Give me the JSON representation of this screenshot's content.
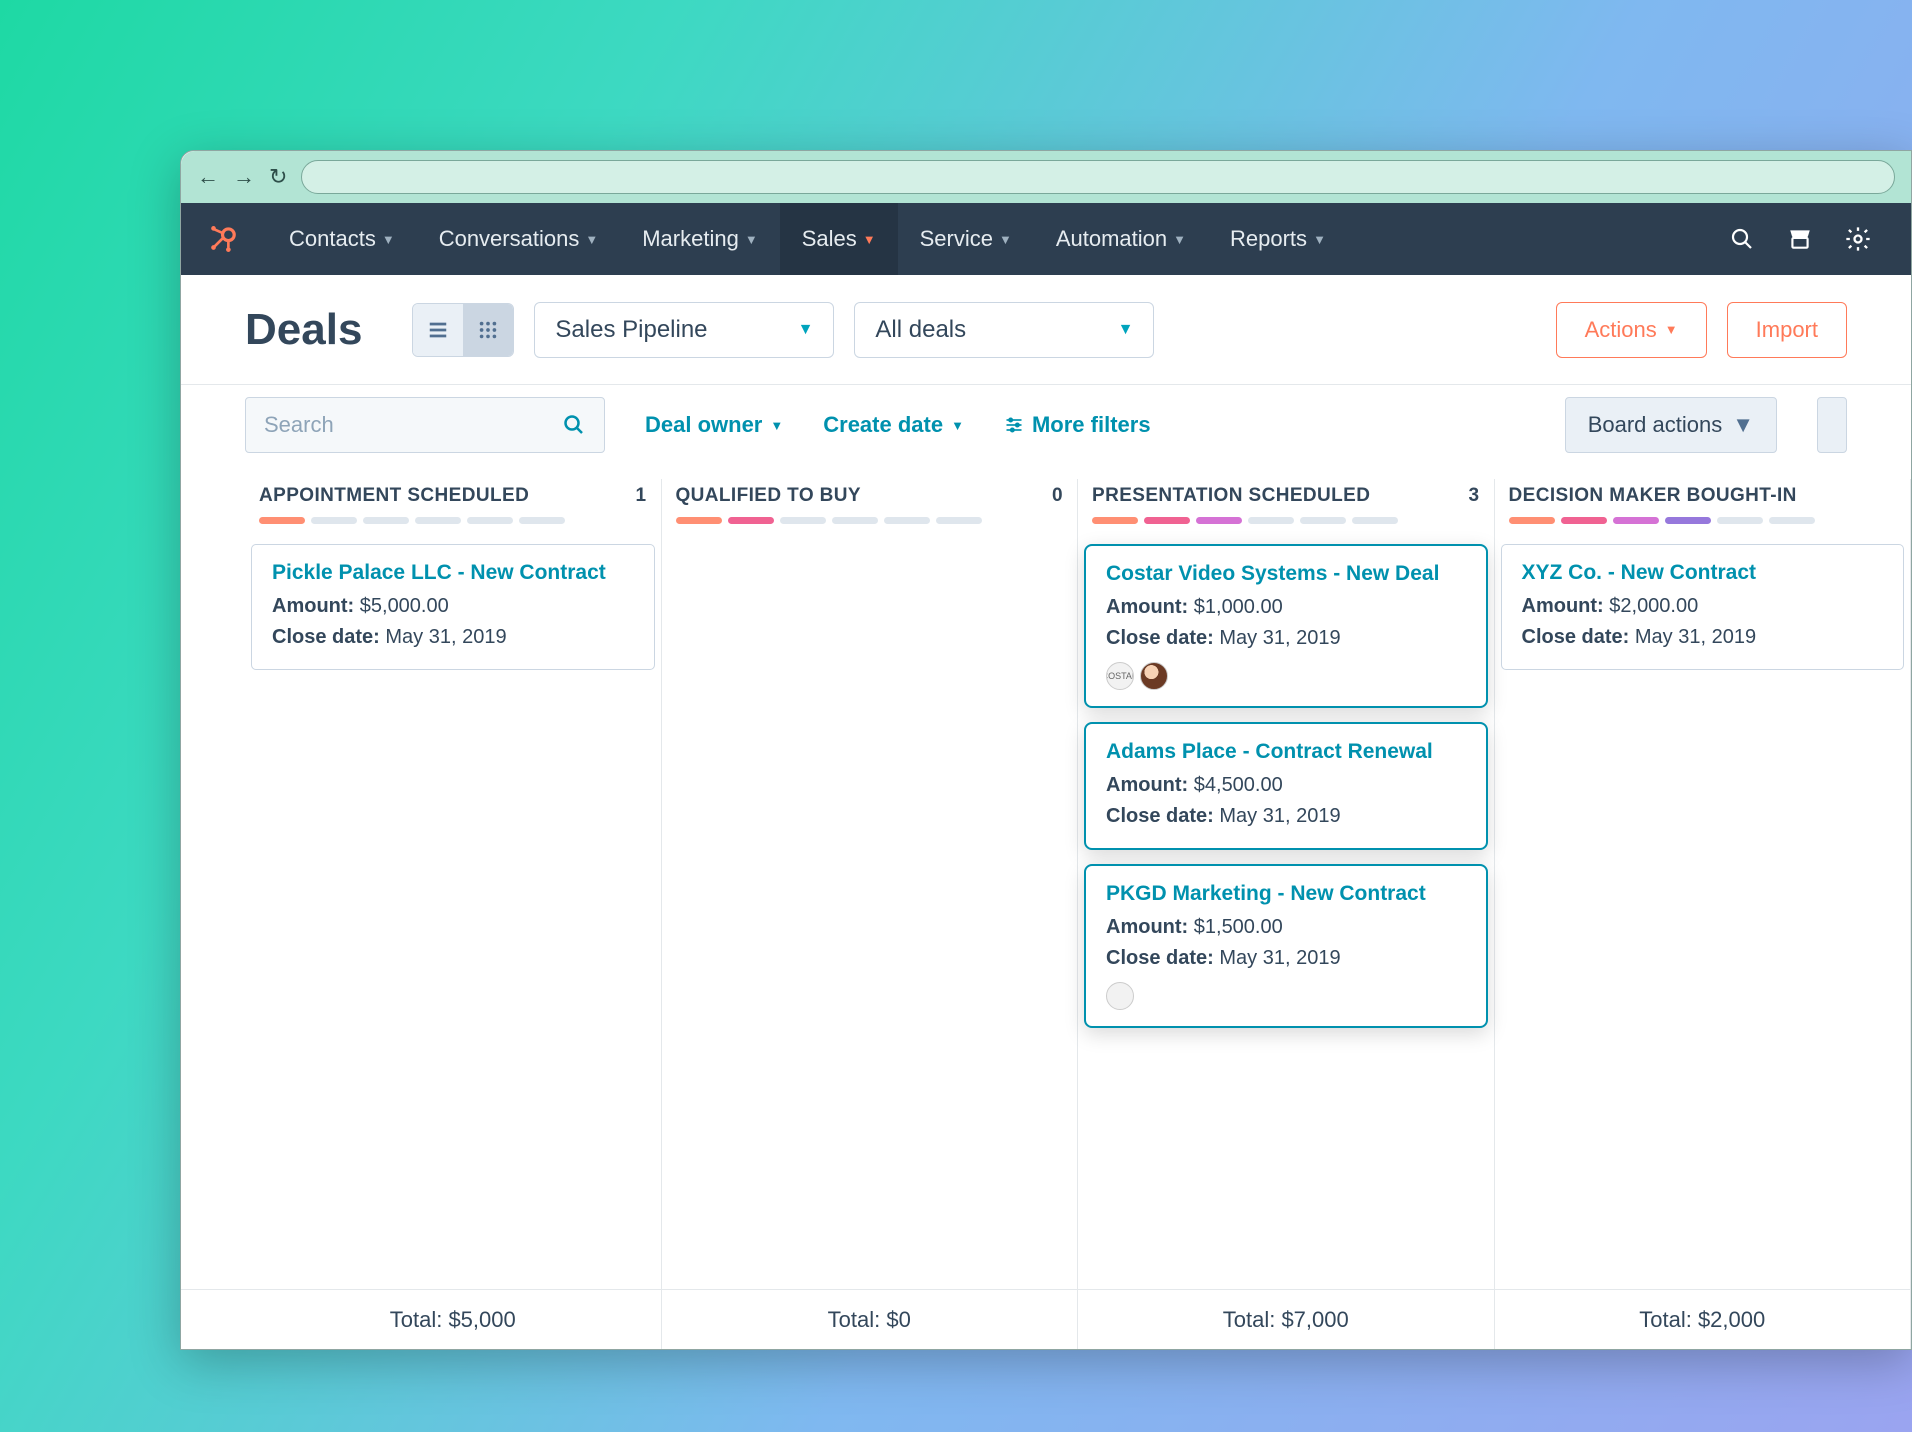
{
  "nav": {
    "items": [
      "Contacts",
      "Conversations",
      "Marketing",
      "Sales",
      "Service",
      "Automation",
      "Reports"
    ],
    "activeIndex": 3
  },
  "page": {
    "title": "Deals"
  },
  "toolbar": {
    "pipeline": "Sales Pipeline",
    "dealsFilter": "All deals",
    "actions": "Actions",
    "import": "Import"
  },
  "filters": {
    "searchPlaceholder": "Search",
    "owner": "Deal owner",
    "createDate": "Create date",
    "more": "More filters",
    "boardActions": "Board actions"
  },
  "labels": {
    "amount": "Amount:",
    "closeDate": "Close date:",
    "total": "Total:"
  },
  "columns": [
    {
      "title": "APPOINTMENT SCHEDULED",
      "count": "1",
      "segments": 1,
      "total": "$5,000",
      "cards": [
        {
          "title": "Pickle Palace LLC - New Contract",
          "amount": "$5,000.00",
          "closeDate": "May 31, 2019",
          "highlight": false,
          "avatars": []
        }
      ]
    },
    {
      "title": "QUALIFIED TO BUY",
      "count": "0",
      "segments": 2,
      "total": "$0",
      "cards": []
    },
    {
      "title": "PRESENTATION SCHEDULED",
      "count": "3",
      "segments": 3,
      "total": "$7,000",
      "cards": [
        {
          "title": "Costar Video Systems - New Deal",
          "amount": "$1,000.00",
          "closeDate": "May 31, 2019",
          "highlight": true,
          "avatars": [
            "logo",
            "pic"
          ]
        },
        {
          "title": "Adams Place - Contract Renewal",
          "amount": "$4,500.00",
          "closeDate": "May 31, 2019",
          "highlight": true,
          "avatars": []
        },
        {
          "title": "PKGD Marketing - New Contract",
          "amount": "$1,500.00",
          "closeDate": "May 31, 2019",
          "highlight": true,
          "avatars": [
            "blank"
          ]
        }
      ]
    },
    {
      "title": "DECISION MAKER BOUGHT-IN",
      "count": "",
      "segments": 4,
      "total": "$2,000",
      "cards": [
        {
          "title": "XYZ Co. - New Contract",
          "amount": "$2,000.00",
          "closeDate": "May 31, 2019",
          "highlight": false,
          "avatars": []
        }
      ]
    }
  ]
}
